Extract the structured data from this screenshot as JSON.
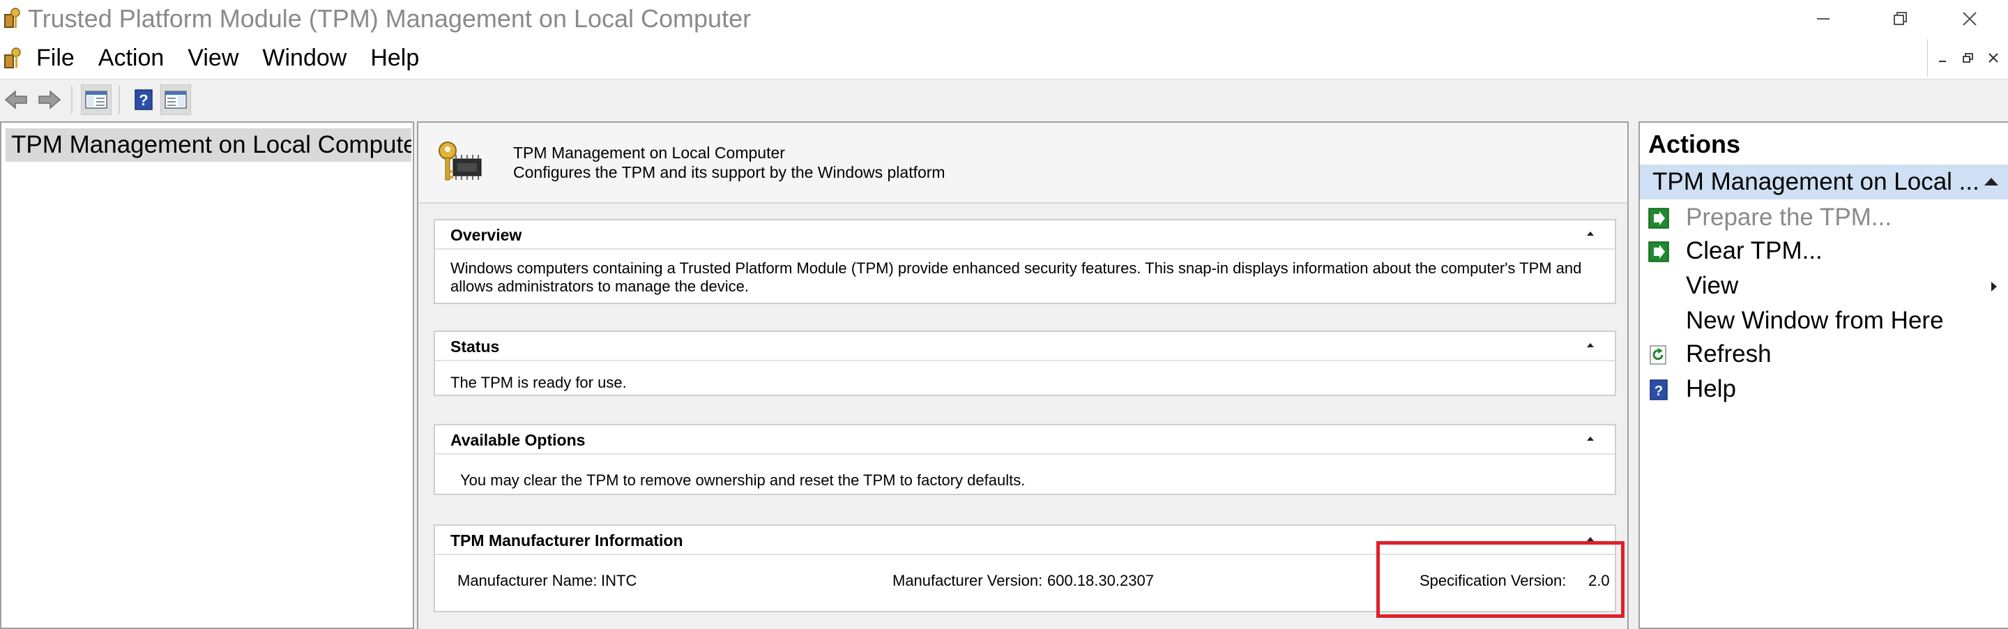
{
  "window": {
    "title": "Trusted Platform Module (TPM) Management on Local Computer"
  },
  "menu": [
    "File",
    "Action",
    "View",
    "Window",
    "Help"
  ],
  "tree": {
    "root_label": "TPM Management on Local Computer"
  },
  "header": {
    "title": "TPM Management on Local Computer",
    "description": "Configures the TPM and its support by the Windows platform"
  },
  "sections": {
    "overview": {
      "title": "Overview",
      "text": "Windows computers containing a Trusted Platform Module (TPM) provide enhanced security features. This snap-in displays information about the computer's TPM and allows administrators to manage the device."
    },
    "status": {
      "title": "Status",
      "text": "The TPM is ready for use."
    },
    "options": {
      "title": "Available Options",
      "text": "You may clear the TPM to remove ownership and reset the TPM to factory defaults."
    },
    "manufacturer": {
      "title": "TPM Manufacturer Information",
      "name_label": "Manufacturer Name:",
      "name_value": "INTC",
      "version_label": "Manufacturer Version:",
      "version_value": "600.18.30.2307",
      "spec_label": "Specification Version:",
      "spec_value": "2.0"
    }
  },
  "actions": {
    "title": "Actions",
    "group_label": "TPM Management on Local ...",
    "items": [
      {
        "label": "Prepare the TPM...",
        "disabled": true,
        "icon": "green-action-icon"
      },
      {
        "label": "Clear TPM...",
        "disabled": false,
        "icon": "green-action-icon"
      },
      {
        "label": "View",
        "disabled": false,
        "icon": "",
        "submenu": true
      },
      {
        "label": "New Window from Here",
        "disabled": false,
        "icon": ""
      },
      {
        "label": "Refresh",
        "disabled": false,
        "icon": "refresh-icon"
      },
      {
        "label": "Help",
        "disabled": false,
        "icon": "help-icon"
      }
    ]
  },
  "colors": {
    "accent_selection": "#cfe0f4",
    "highlight_box": "#e0202a",
    "action_green": "#1f8a2e",
    "help_blue": "#2b4fa8"
  }
}
